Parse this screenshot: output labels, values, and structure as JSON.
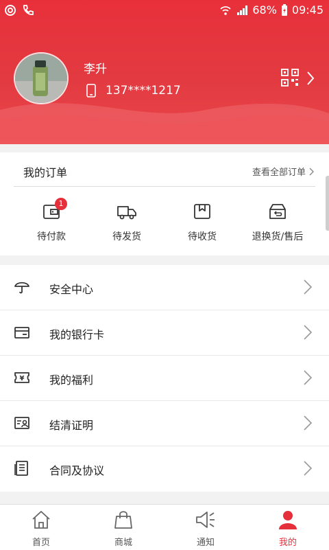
{
  "status": {
    "battery": "68%",
    "time": "09:45"
  },
  "profile": {
    "name": "李升",
    "phone": "137****1217"
  },
  "orders": {
    "title": "我的订单",
    "view_all": "查看全部订单",
    "items": [
      {
        "label": "待付款",
        "icon": "wallet-icon",
        "badge": "1"
      },
      {
        "label": "待发货",
        "icon": "truck-icon"
      },
      {
        "label": "待收货",
        "icon": "box-icon"
      },
      {
        "label": "退换货/售后",
        "icon": "return-icon"
      }
    ]
  },
  "menu": [
    {
      "label": "安全中心",
      "icon": "umbrella-icon"
    },
    {
      "label": "我的银行卡",
      "icon": "bank-card-icon"
    },
    {
      "label": "我的福利",
      "icon": "coupon-icon"
    },
    {
      "label": "结清证明",
      "icon": "certificate-icon"
    },
    {
      "label": "合同及协议",
      "icon": "document-icon"
    }
  ],
  "tabs": [
    {
      "label": "首页",
      "icon": "home-icon"
    },
    {
      "label": "商城",
      "icon": "shopping-bag-icon"
    },
    {
      "label": "通知",
      "icon": "megaphone-icon"
    },
    {
      "label": "我的",
      "icon": "person-icon",
      "active": true
    }
  ],
  "colors": {
    "brand": "#e5303b",
    "header": "#e8303a"
  }
}
